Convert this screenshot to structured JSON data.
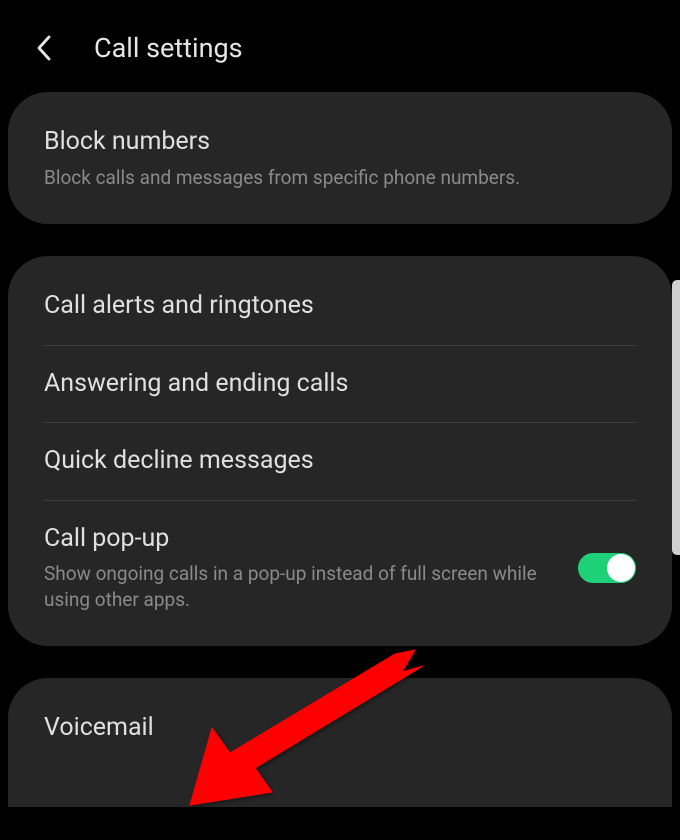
{
  "header": {
    "title": "Call settings"
  },
  "card1": {
    "item1": {
      "title": "Block numbers",
      "subtitle": "Block calls and messages from specific phone numbers."
    }
  },
  "card2": {
    "item1": {
      "title": "Call alerts and ringtones"
    },
    "item2": {
      "title": "Answering and ending calls"
    },
    "item3": {
      "title": "Quick decline messages"
    },
    "item4": {
      "title": "Call pop-up",
      "subtitle": "Show ongoing calls in a pop-up instead of full screen while using other apps."
    }
  },
  "card3": {
    "item1": {
      "title": "Voicemail"
    }
  },
  "toggleState": "on",
  "colors": {
    "toggleAccent": "#1ed179",
    "arrow": "#ff0000"
  }
}
